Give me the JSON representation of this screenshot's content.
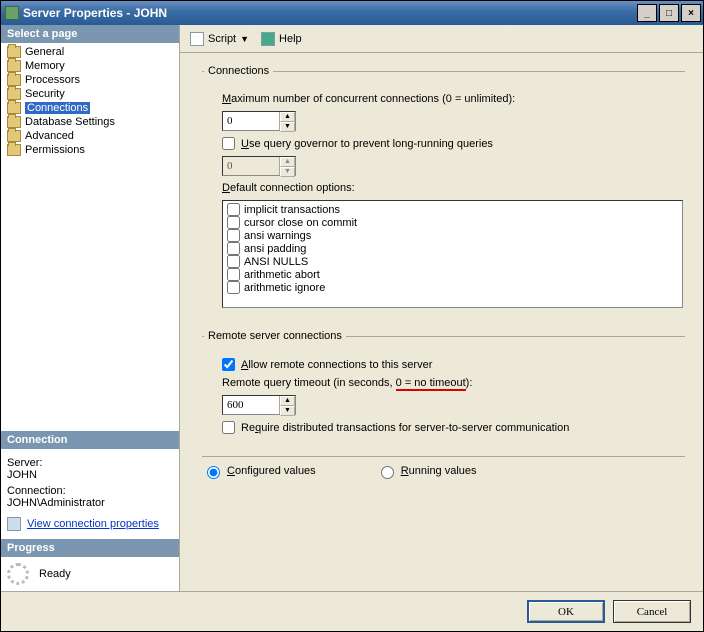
{
  "window": {
    "title": "Server Properties - JOHN"
  },
  "sidebar": {
    "header": "Select a page",
    "items": [
      {
        "label": "General"
      },
      {
        "label": "Memory"
      },
      {
        "label": "Processors"
      },
      {
        "label": "Security"
      },
      {
        "label": "Connections",
        "selected": true
      },
      {
        "label": "Database Settings"
      },
      {
        "label": "Advanced"
      },
      {
        "label": "Permissions"
      }
    ],
    "connection": {
      "header": "Connection",
      "server_label": "Server:",
      "server_value": "JOHN",
      "conn_label": "Connection:",
      "conn_value": "JOHN\\Administrator",
      "view_link": "View connection properties"
    },
    "progress": {
      "header": "Progress",
      "status": "Ready"
    }
  },
  "toolbar": {
    "script": "Script",
    "help": "Help"
  },
  "sections": {
    "connections": {
      "legend": "Connections",
      "max_conn_label": "Maximum number of concurrent connections (0 = unlimited):",
      "max_conn_value": "0",
      "query_gov_label": "Use query governor to prevent long-running queries",
      "query_gov_value": "0",
      "default_opts_label": "Default connection options:",
      "options": [
        "implicit transactions",
        "cursor close on commit",
        "ansi warnings",
        "ansi padding",
        "ANSI NULLS",
        "arithmetic abort",
        "arithmetic ignore"
      ]
    },
    "remote": {
      "legend": "Remote server connections",
      "allow_label": "Allow remote connections to this server",
      "timeout_label_pre": "Remote query timeout (in seconds, ",
      "timeout_label_hl": "0 = no timeout",
      "timeout_label_post": "):",
      "timeout_value": "600",
      "require_dt_label": "Require distributed transactions for server-to-server communication"
    },
    "radios": {
      "configured": "Configured values",
      "running": "Running values"
    }
  },
  "footer": {
    "ok": "OK",
    "cancel": "Cancel"
  }
}
